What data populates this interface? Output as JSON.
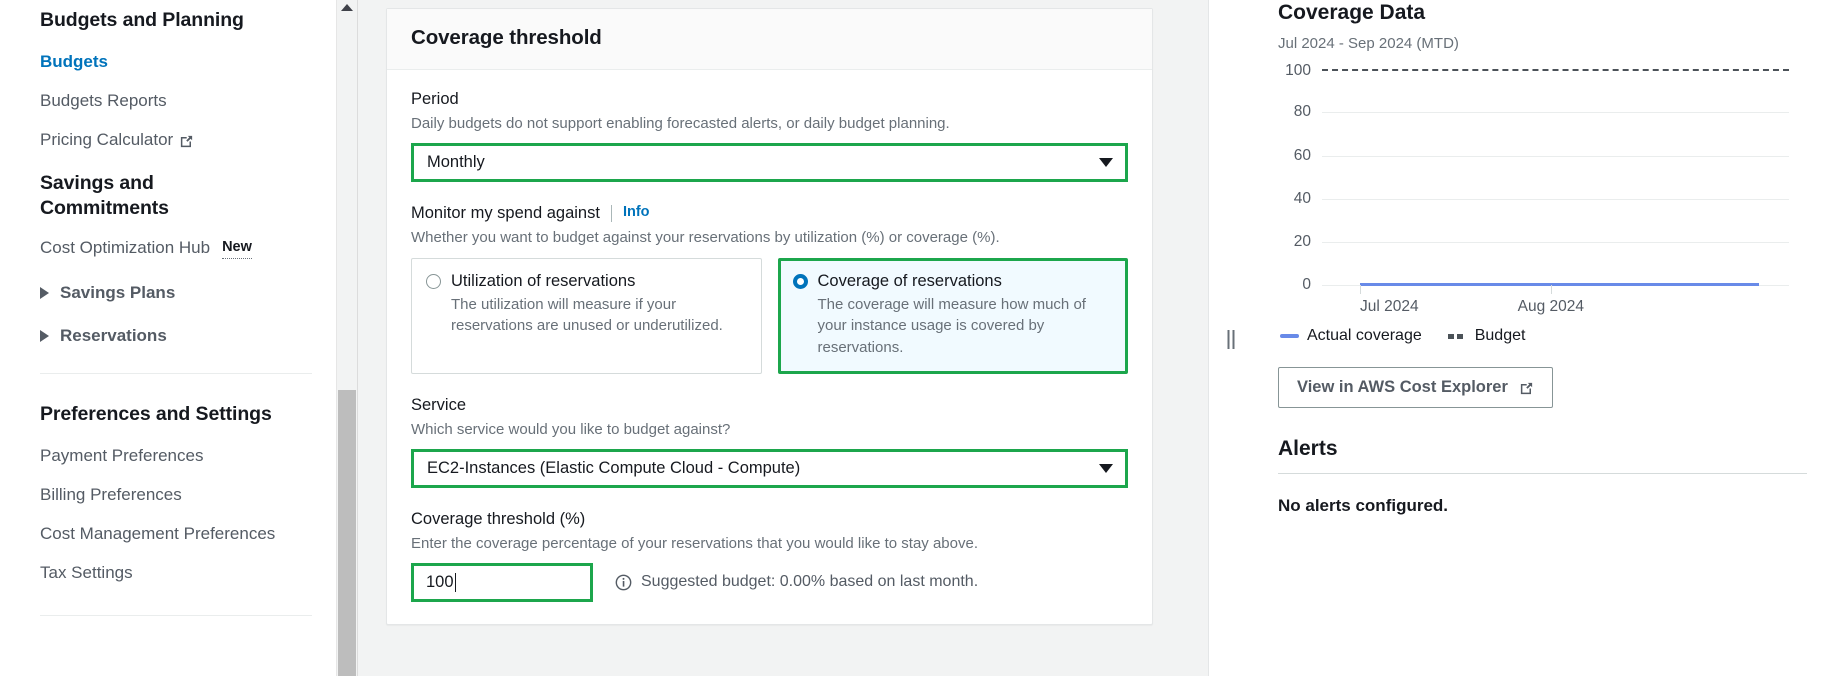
{
  "sidebar": {
    "groups": [
      {
        "title": "Budgets and Planning",
        "items": [
          {
            "label": "Budgets",
            "active": true,
            "external": false
          },
          {
            "label": "Budgets Reports",
            "active": false,
            "external": false
          },
          {
            "label": "Pricing Calculator",
            "active": false,
            "external": true
          }
        ]
      },
      {
        "title": "Savings and Commitments",
        "items": [
          {
            "label": "Cost Optimization Hub",
            "badge": "New",
            "active": false,
            "external": false
          }
        ],
        "expandables": [
          {
            "label": "Savings Plans"
          },
          {
            "label": "Reservations"
          }
        ]
      },
      {
        "title": "Preferences and Settings",
        "items": [
          {
            "label": "Payment Preferences",
            "active": false,
            "external": false
          },
          {
            "label": "Billing Preferences",
            "active": false,
            "external": false
          },
          {
            "label": "Cost Management Preferences",
            "active": false,
            "external": false
          },
          {
            "label": "Tax Settings",
            "active": false,
            "external": false
          }
        ]
      }
    ]
  },
  "card": {
    "title": "Coverage threshold",
    "period": {
      "label": "Period",
      "description": "Daily budgets do not support enabling forecasted alerts, or daily budget planning.",
      "value": "Monthly"
    },
    "monitor": {
      "label": "Monitor my spend against",
      "info_link": "Info",
      "description": "Whether you want to budget against your reservations by utilization (%) or coverage (%).",
      "options": [
        {
          "title": "Utilization of reservations",
          "description": "The utilization will measure if your reservations are unused or underutilized.",
          "selected": false
        },
        {
          "title": "Coverage of reservations",
          "description": "The coverage will measure how much of your instance usage is covered by reservations.",
          "selected": true
        }
      ]
    },
    "service": {
      "label": "Service",
      "description": "Which service would you like to budget against?",
      "value": "EC2-Instances (Elastic Compute Cloud - Compute)"
    },
    "threshold": {
      "label": "Coverage threshold (%)",
      "description": "Enter the coverage percentage of your reservations that you would like to stay above.",
      "value": "100",
      "placeholder": "",
      "suggestion": "Suggested budget: 0.00% based on last month."
    }
  },
  "right_panel": {
    "title": "Coverage Data",
    "subtitle": "Jul 2024 - Sep 2024 (MTD)",
    "legend": [
      {
        "label": "Actual coverage",
        "style": "solid",
        "color": "#688ae8"
      },
      {
        "label": "Budget",
        "style": "dashed",
        "color": "#4b5258"
      }
    ],
    "cost_explorer_button": "View in AWS Cost Explorer",
    "alerts": {
      "title": "Alerts",
      "empty_text": "No alerts configured."
    }
  },
  "colors": {
    "focus_green": "#1ca64c",
    "link_blue": "#0073bb",
    "radio_blue": "#0073bb",
    "series_blue": "#688ae8",
    "budget_gray": "#4b5258"
  },
  "chart_data": {
    "type": "line",
    "title": "Coverage Data",
    "subtitle": "Jul 2024 - Sep 2024 (MTD)",
    "xlabel": "",
    "ylabel": "",
    "ylim": [
      0,
      100
    ],
    "yticks": [
      0,
      20,
      40,
      60,
      80,
      100
    ],
    "ytick_labels": [
      "0",
      "20",
      "40",
      "60",
      "80",
      "100"
    ],
    "x": [
      "Jul 2024",
      "Aug 2024",
      "Sep 2024"
    ],
    "xtick_labels": [
      "Jul 2024",
      "Aug 2024"
    ],
    "grid": true,
    "legend_position": "bottom-left",
    "series": [
      {
        "name": "Actual coverage",
        "style": "solid",
        "color": "#688ae8",
        "values": [
          0,
          0,
          0
        ]
      },
      {
        "name": "Budget",
        "style": "dashed",
        "color": "#4b5258",
        "values": [
          100,
          100,
          100
        ]
      }
    ]
  }
}
